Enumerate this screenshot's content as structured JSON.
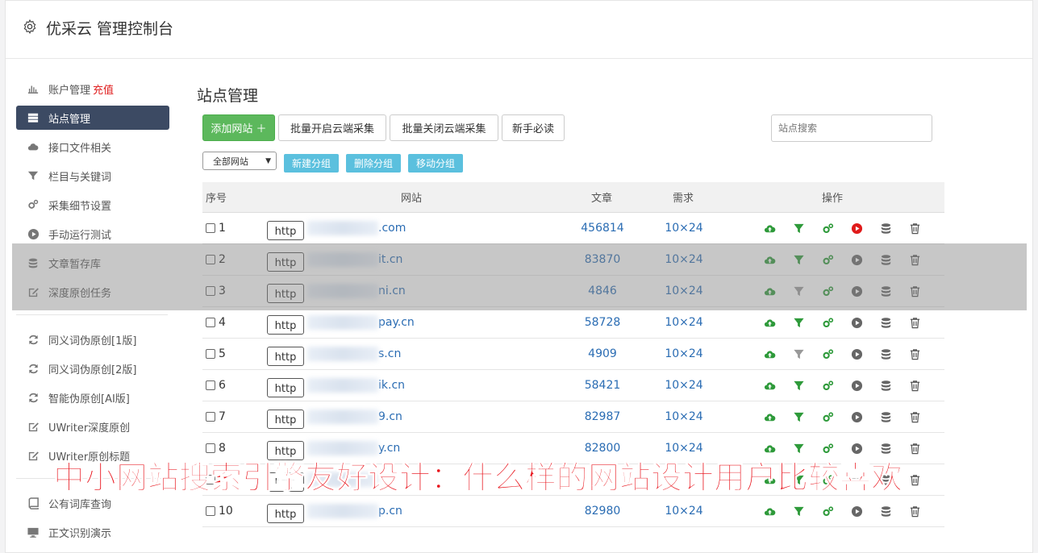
{
  "app": {
    "title": "优采云 管理控制台"
  },
  "sidebar": {
    "items": [
      {
        "label": "账户管理",
        "extra": "充值",
        "icon": "bar-chart-icon"
      },
      {
        "label": "站点管理",
        "icon": "server-icon",
        "active": true
      },
      {
        "label": "接口文件相关",
        "icon": "cloud-upload-icon"
      },
      {
        "label": "栏目与关键词",
        "icon": "filter-icon"
      },
      {
        "label": "采集细节设置",
        "icon": "cogs-icon"
      },
      {
        "label": "手动运行测试",
        "icon": "play-icon"
      },
      {
        "label": "文章暂存库",
        "icon": "database-icon"
      },
      {
        "label": "深度原创任务",
        "icon": "edit-icon"
      }
    ],
    "items2": [
      {
        "label": "同义词伪原创[1版]",
        "icon": "refresh-icon"
      },
      {
        "label": "同义词伪原创[2版]",
        "icon": "refresh-icon"
      },
      {
        "label": "智能伪原创[AI版]",
        "icon": "refresh-icon"
      },
      {
        "label": "UWriter深度原创",
        "icon": "edit-icon"
      },
      {
        "label": "UWriter原创标题",
        "icon": "edit-icon"
      }
    ],
    "items3": [
      {
        "label": "公有词库查询",
        "icon": "book-icon"
      },
      {
        "label": "正文识别演示",
        "icon": "monitor-icon"
      }
    ]
  },
  "main": {
    "page_title": "站点管理",
    "toolbar": {
      "add_site": "添加网站 ＋",
      "batch_open": "批量开启云端采集",
      "batch_close": "批量关闭云端采集",
      "newbie": "新手必读"
    },
    "search": {
      "placeholder": "站点搜索"
    },
    "group_select": {
      "value": "全部网站"
    },
    "group_buttons": {
      "new": "新建分组",
      "delete": "删除分组",
      "move": "移动分组"
    },
    "table": {
      "headers": {
        "no": "序号",
        "site": "网站",
        "articles": "文章",
        "demand": "需求",
        "ops": "操作"
      },
      "http_label": "http",
      "rows": [
        {
          "no": "1",
          "site": ".com",
          "articles": "456814",
          "demand": "10×24",
          "running": true
        },
        {
          "no": "2",
          "site": "it.cn",
          "articles": "83870",
          "demand": "10×24"
        },
        {
          "no": "3",
          "site": "ni.cn",
          "articles": "4846",
          "demand": "10×24",
          "filter_off": true
        },
        {
          "no": "4",
          "site": "pay.cn",
          "articles": "58728",
          "demand": "10×24"
        },
        {
          "no": "5",
          "site": "s.cn",
          "articles": "4909",
          "demand": "10×24",
          "filter_off": true
        },
        {
          "no": "6",
          "site": "ik.cn",
          "articles": "58421",
          "demand": "10×24"
        },
        {
          "no": "7",
          "site": "9.cn",
          "articles": "82987",
          "demand": "10×24"
        },
        {
          "no": "8",
          "site": "y.cn",
          "articles": "82800",
          "demand": "10×24"
        },
        {
          "no": "9",
          "site": "",
          "articles": "",
          "demand": ""
        },
        {
          "no": "10",
          "site": "p.cn",
          "articles": "82980",
          "demand": "10×24"
        }
      ]
    }
  },
  "overlay_caption": "中小网站搜索引擎友好设计：什么样的网站设计用户比较喜欢",
  "colors": {
    "accent": "#3c4a63",
    "green": "#5cb85c",
    "info": "#5bc0de",
    "link": "#2a6cb3",
    "caption": "#e8141c"
  }
}
